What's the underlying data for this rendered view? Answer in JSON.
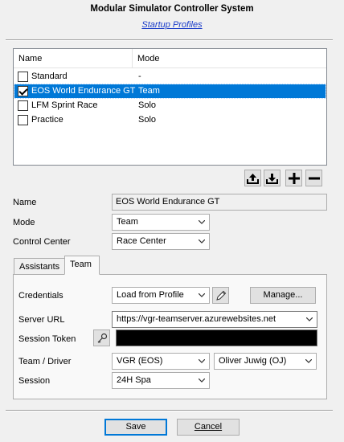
{
  "window": {
    "title": "Modular Simulator Controller System",
    "subtitle_link": "Startup Profiles"
  },
  "profiles": {
    "columns": [
      "Name",
      "Mode"
    ],
    "rows": [
      {
        "name": "Standard",
        "mode": "-",
        "checked": false,
        "selected": false
      },
      {
        "name": "EOS World Endurance GT",
        "mode": "Team",
        "checked": true,
        "selected": true
      },
      {
        "name": "LFM Sprint Race",
        "mode": "Solo",
        "checked": false,
        "selected": false
      },
      {
        "name": "Practice",
        "mode": "Solo",
        "checked": false,
        "selected": false
      }
    ]
  },
  "toolbar": {
    "icons": [
      "upload-icon",
      "download-icon",
      "plus-icon",
      "minus-icon"
    ]
  },
  "form": {
    "name_label": "Name",
    "name_value": "EOS World Endurance GT",
    "mode_label": "Mode",
    "mode_value": "Team",
    "control_center_label": "Control Center",
    "control_center_value": "Race Center"
  },
  "tabs": {
    "items": [
      "Assistants",
      "Team"
    ],
    "active": "Team"
  },
  "team": {
    "credentials_label": "Credentials",
    "credentials_value": "Load from Profile",
    "manage_label": "Manage...",
    "server_url_label": "Server URL",
    "server_url_value": "https://vgr-teamserver.azurewebsites.net",
    "session_token_label": "Session Token",
    "team_driver_label": "Team / Driver",
    "team_value": "VGR (EOS)",
    "driver_value": "Oliver Juwig (OJ)",
    "session_label": "Session",
    "session_value": "24H Spa"
  },
  "footer": {
    "save_label": "Save",
    "cancel_label": "Cancel"
  }
}
